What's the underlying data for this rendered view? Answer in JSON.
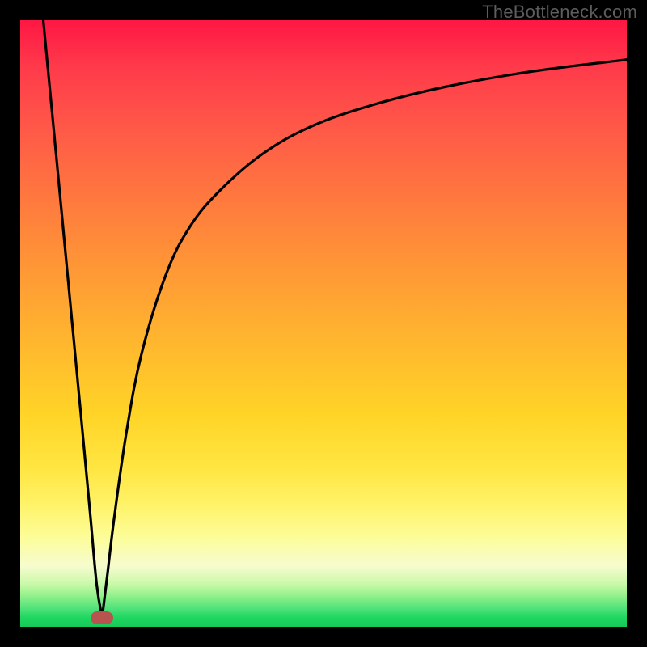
{
  "watermark": "TheBottleneck.com",
  "chart_data": {
    "type": "line",
    "title": "",
    "xlabel": "",
    "ylabel": "",
    "xlim": [
      0,
      100
    ],
    "ylim": [
      0,
      100
    ],
    "min_marker": {
      "x": 13.5,
      "y": 1.5
    },
    "series": [
      {
        "name": "bottleneck-curve-left",
        "x": [
          3.8,
          6,
          8,
          10,
          11.5,
          12.6,
          13.5
        ],
        "values": [
          100,
          77,
          56,
          35,
          19,
          7,
          1.5
        ]
      },
      {
        "name": "bottleneck-curve-right",
        "x": [
          13.5,
          14.3,
          15.5,
          17.5,
          20,
          24,
          28,
          33,
          40,
          48,
          58,
          70,
          84,
          100
        ],
        "values": [
          1.5,
          8,
          18,
          32,
          45,
          58,
          66,
          72,
          78,
          82.5,
          86,
          89,
          91.5,
          93.5
        ]
      }
    ],
    "gradient_stops": [
      {
        "pct": 0,
        "color": "#ff1744"
      },
      {
        "pct": 18,
        "color": "#ff5948"
      },
      {
        "pct": 42,
        "color": "#ff9a35"
      },
      {
        "pct": 65,
        "color": "#ffd427"
      },
      {
        "pct": 85,
        "color": "#fdfd96"
      },
      {
        "pct": 95,
        "color": "#8ff08a"
      },
      {
        "pct": 100,
        "color": "#18c85a"
      }
    ]
  }
}
